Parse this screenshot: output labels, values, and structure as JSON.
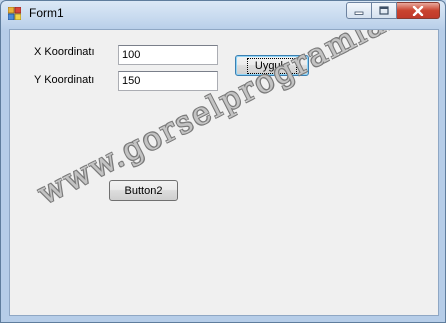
{
  "window": {
    "title": "Form1",
    "icon": "form-app-icon",
    "controls": [
      "minimize-icon",
      "maximize-icon",
      "close-icon"
    ]
  },
  "form": {
    "x_label": "X Koordinatı",
    "x_value": "100",
    "y_label": "Y Koordinatı",
    "y_value": "150",
    "apply_button": "Uygula",
    "button2": "Button2"
  },
  "watermark": "www.gorselprogramlama.com"
}
